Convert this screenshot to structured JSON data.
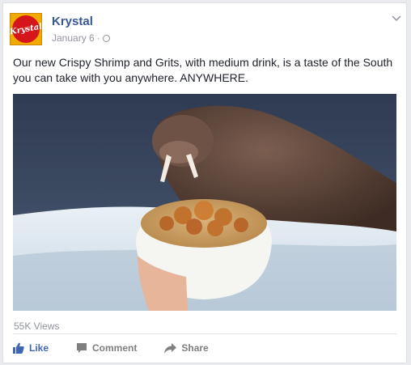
{
  "post": {
    "page_name": "Krystal",
    "avatar_text": "Krystal",
    "date": "January 6",
    "separator": "·",
    "privacy_icon": "globe-icon",
    "menu_icon": "chevron-down-icon",
    "text": "Our new Crispy Shrimp and Grits, with medium drink, is a taste of the South you can take with you anywhere. ANYWHERE."
  },
  "media": {
    "description_icon": "video-thumbnail"
  },
  "stats": {
    "views": "55K Views"
  },
  "actions": {
    "like_label": "Like",
    "comment_label": "Comment",
    "share_label": "Share",
    "like_icon": "thumbs-up-icon",
    "comment_icon": "comment-icon",
    "share_icon": "share-icon"
  },
  "colors": {
    "link": "#365899",
    "like": "#4267b2",
    "muted": "#90949c",
    "text": "#1d2129",
    "brand_yellow": "#f2a900",
    "brand_red": "#d4161c"
  }
}
